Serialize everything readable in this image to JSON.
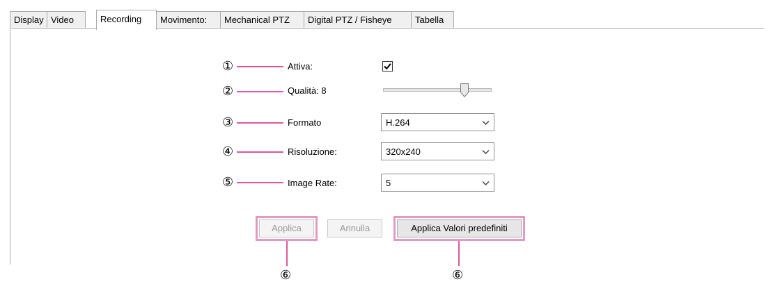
{
  "tabs": [
    {
      "label": "Display"
    },
    {
      "label": "Video"
    },
    {
      "label": "Recording",
      "active": true
    },
    {
      "label": "Movimento:"
    },
    {
      "label": "Mechanical PTZ"
    },
    {
      "label": "Digital PTZ / Fisheye"
    },
    {
      "label": "Tabella"
    }
  ],
  "callouts": {
    "c1": "①",
    "c2": "②",
    "c3": "③",
    "c4": "④",
    "c5": "⑤",
    "c6a": "⑥",
    "c6b": "⑥"
  },
  "form": {
    "attiva_label": "Attiva:",
    "attiva_checked": true,
    "qualita_label": "Qualità: 8",
    "qualita_value": 8,
    "formato_label": "Formato",
    "formato_value": "H.264",
    "risoluzione_label": "Risoluzione:",
    "risoluzione_value": "320x240",
    "image_rate_label": "Image Rate:",
    "image_rate_value": "5"
  },
  "buttons": {
    "applica": "Applica",
    "annulla": "Annulla",
    "applica_default": "Applica Valori predefiniti"
  },
  "colors": {
    "callout_line": "#e0569b",
    "highlight_frame": "#e49ac0"
  }
}
